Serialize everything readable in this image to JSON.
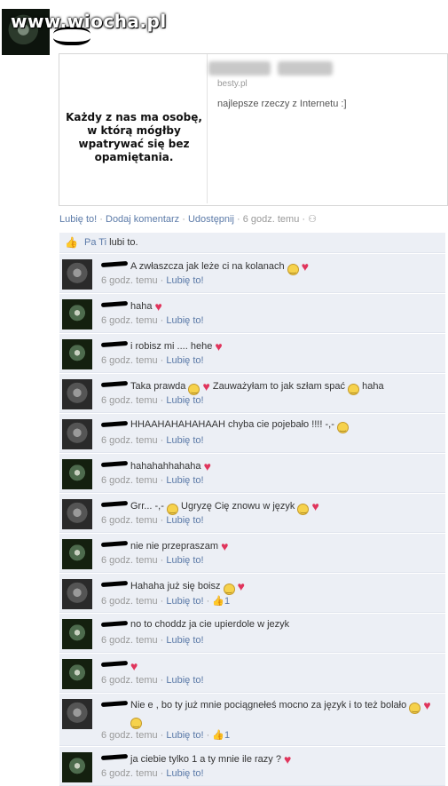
{
  "watermark": "www.wiocha.pl",
  "share": {
    "image_text": "Każdy z nas ma osobę, w którą mógłby wpatrywać się bez opamiętania.",
    "domain": "besty.pl",
    "description": "najlepsze rzeczy z Internetu :]"
  },
  "post_actions": {
    "like": "Lubię to!",
    "comment": "Dodaj komentarz",
    "share": "Udostępnij",
    "time": "6 godz. temu"
  },
  "likes_bar": {
    "who": "Pa Ti",
    "text": "lubi to."
  },
  "comment_meta": {
    "time": "6 godz. temu",
    "like": "Lubię to!"
  },
  "comments": [
    {
      "avatar": "av-a",
      "text": "A zwłaszcza jak leże ci na kolanach",
      "emoji": [
        "smile",
        "heart"
      ],
      "likes": ""
    },
    {
      "avatar": "av-b",
      "text": "haha",
      "emoji": [
        "heart"
      ],
      "likes": ""
    },
    {
      "avatar": "av-b",
      "text": "i robisz mi .... hehe",
      "emoji": [
        "heart"
      ],
      "likes": ""
    },
    {
      "avatar": "av-a",
      "text": "Taka prawda",
      "emoji": [
        "smile",
        "heart"
      ],
      "text2": "Zauważyłam to jak szłam spać",
      "emoji2": [
        "smile"
      ],
      "text3": "haha",
      "likes": ""
    },
    {
      "avatar": "av-a",
      "text": "HHAAHAHAHAHAAH chyba cie pojebało !!!! -,-",
      "emoji": [
        "smile"
      ],
      "likes": ""
    },
    {
      "avatar": "av-b",
      "text": "hahahahhahaha",
      "emoji": [
        "heart"
      ],
      "likes": ""
    },
    {
      "avatar": "av-a",
      "text": "Grr... -,-",
      "emoji": [
        "smile"
      ],
      "text2": "Ugryzę Cię znowu w język",
      "emoji2": [
        "smile",
        "heart"
      ],
      "likes": ""
    },
    {
      "avatar": "av-b",
      "text": "nie nie przepraszam",
      "emoji": [
        "heart"
      ],
      "likes": ""
    },
    {
      "avatar": "av-a",
      "text": "Hahaha już się boisz",
      "emoji": [
        "smile",
        "heart"
      ],
      "likes": "1"
    },
    {
      "avatar": "av-b",
      "text": "no to choddz ja cie upierdole w jezyk",
      "emoji": [],
      "likes": ""
    },
    {
      "avatar": "av-b",
      "text": "",
      "emoji": [
        "heart"
      ],
      "likes": ""
    },
    {
      "avatar": "av-a",
      "text": "Nie e , bo ty już mnie pociągnełeś mocno za język i to też bolało",
      "emoji": [
        "smile",
        "heart",
        "smile"
      ],
      "likes": "1"
    },
    {
      "avatar": "av-b",
      "text": "ja ciebie tylko 1 a ty mnie ile razy ?",
      "emoji": [
        "heart"
      ],
      "likes": ""
    }
  ],
  "colors": {
    "link": "#5b7aa8",
    "comment_bg": "#eceff5",
    "heart": "#e0355c"
  }
}
